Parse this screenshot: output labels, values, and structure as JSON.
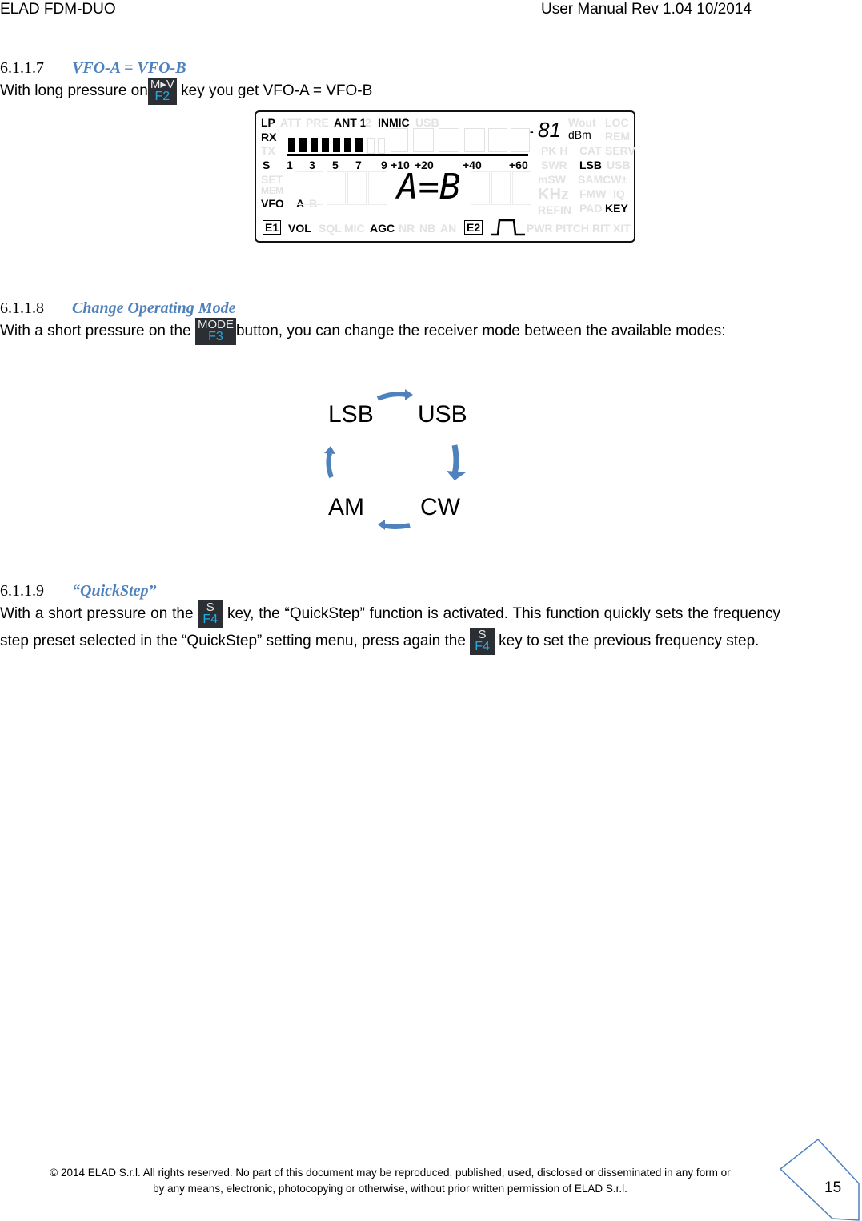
{
  "header": {
    "left": "ELAD FDM-DUO",
    "right": "User Manual Rev 1.04   10/2014"
  },
  "sections": [
    {
      "number": "6.1.1.7",
      "title": "VFO-A = VFO-B",
      "text_before": "With long pressure on",
      "key": {
        "top": "M▸V",
        "bottom": "F2"
      },
      "text_after": " key you get VFO-A = VFO-B"
    },
    {
      "number": "6.1.1.8",
      "title": "Change Operating Mode",
      "text_before": "With a short pressure on the ",
      "key": {
        "top": "MODE",
        "bottom": "F3"
      },
      "text_after": "button, you can change the receiver mode between the available modes:"
    },
    {
      "number": "6.1.1.9",
      "title": "“QuickStep”",
      "text_1": "With a short pressure on the ",
      "key": {
        "top": "S",
        "bottom": "F4"
      },
      "text_2": " key, the “QuickStep” function is activated. This function quickly sets the frequency step preset selected in the “QuickStep” setting menu, press again the ",
      "text_3": " key to set the previous frequency step."
    }
  ],
  "lcd": {
    "row1": {
      "lp": "LP",
      "att": "ATT",
      "pre": "PRE",
      "ant": "ANT 1",
      "ant2": "2",
      "inmic": "INMIC",
      "usb": "USB"
    },
    "rx": "RX",
    "tx": "TX",
    "s_label": "S",
    "scale": [
      "1",
      "3",
      "5",
      "7",
      "9",
      "+10",
      "+20",
      "+40",
      "+60"
    ],
    "s_meter_level": "7 of 9 segments lit",
    "dbm_sign": "-",
    "dbm_value": "81",
    "dbm_unit": "dBm",
    "set": "SET",
    "mem": "MEM",
    "vfo": "VFO",
    "vfo_a": "A",
    "vfo_b": "B",
    "main_text": "A=B",
    "right_col": {
      "wout": "Wout",
      "loc": "LOC",
      "rem": "REM",
      "pkh": "PK H",
      "cat": "CAT",
      "serv": "SERV",
      "swr": "SWR",
      "lsb": "LSB",
      "usb": "USB",
      "msw": "mSW",
      "samcw": "SAMCW±",
      "khz": "KHz",
      "fmw": "FMW",
      "iq": "IQ",
      "refin": "REFIN",
      "pad": "PAD",
      "key": "KEY"
    },
    "bottom": {
      "e1": "E1",
      "vol": "VOL",
      "sql": "SQL",
      "mic": "MIC",
      "agc": "AGC",
      "nr": "NR",
      "nb": "NB",
      "an": "AN",
      "e2": "E2",
      "pwr": "PWR",
      "pitch": "PITCH",
      "rit": "RIT",
      "xit": "XIT"
    }
  },
  "mode_cycle": [
    "LSB",
    "USB",
    "CW",
    "AM"
  ],
  "colors": {
    "heading_accent": "#4f81bd",
    "arrow": "#4f81bd",
    "key_bg": "#2b2f33",
    "key_fn": "#28a8e0"
  },
  "footer": {
    "line1": "© 2014 ELAD S.r.l. All rights reserved. No part of this document may be reproduced, published, used, disclosed or disseminated in any form or",
    "line2": "by any means, electronic, photocopying or otherwise, without prior written permission of ELAD S.r.l.",
    "page_number": "15"
  }
}
